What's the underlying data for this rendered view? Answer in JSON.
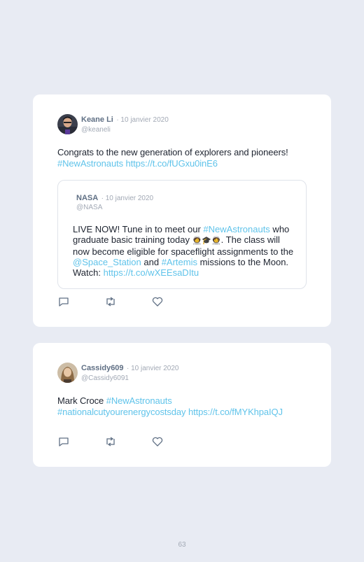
{
  "tweets": [
    {
      "author": "Keane Li",
      "date": "· 10 janvier 2020",
      "handle": "@keaneli",
      "text_plain": "Congrats to the new generation of explorers and pioneers!",
      "hashtag": "#NewAstronauts",
      "url": "https://t.co/fUGxu0inE6",
      "quote": {
        "author": "NASA",
        "date": "· 10 janvier 2020",
        "handle": "@NASA",
        "t1": "LIVE NOW! Tune in to meet our ",
        "hashtag": "#NewAstronauts",
        "t2": " who graduate basic training today ",
        "emoji": "🧑‍🚀🎓🧑‍🚀",
        "t3": ". The class will now become eligible for spaceflight assignments to the ",
        "mention": "@Space_Station",
        "t4": " and ",
        "hashtag2": "#Artemis",
        "t5": " missions to the Moon. Watch: ",
        "url": "https://t.co/wXEEsaDItu"
      }
    },
    {
      "author": "Cassidy609",
      "date": "· 10 janvier 2020",
      "handle": "@Cassidy6091",
      "text_plain": "Mark Croce ",
      "hashtag": "#NewAstronauts",
      "hashtag2": "#nationalcutyourenergycostsday",
      "url": "https://t.co/fMYKhpaIQJ"
    }
  ],
  "icons": [
    "reply-icon",
    "retweet-icon",
    "like-icon"
  ],
  "colors": {
    "link": "#5fc3ea",
    "background": "#e8ebf3",
    "name": "#5f6f84"
  },
  "page_number": "63"
}
